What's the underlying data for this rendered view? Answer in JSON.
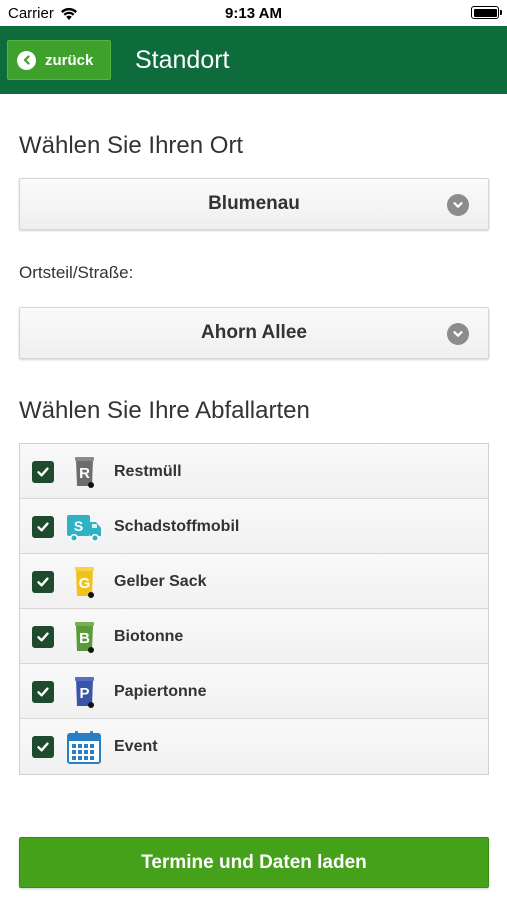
{
  "status_bar": {
    "carrier": "Carrier",
    "time": "9:13 AM",
    "wifi_icon": "wifi-icon",
    "battery_icon": "battery-icon"
  },
  "nav": {
    "back_label": "zurück",
    "title": "Standort"
  },
  "location": {
    "heading": "Wählen Sie Ihren Ort",
    "selected_place": "Blumenau",
    "district_label": "Ortsteil/Straße:",
    "selected_district": "Ahorn Allee"
  },
  "waste_types": {
    "heading": "Wählen Sie Ihre Abfallarten",
    "items": [
      {
        "label": "Restmüll",
        "checked": true,
        "icon": "restmuell-bin-icon",
        "letter": "R",
        "color": "#6d6d6d"
      },
      {
        "label": "Schadstoffmobil",
        "checked": true,
        "icon": "truck-icon",
        "letter": "S",
        "color": "#2fb3c3"
      },
      {
        "label": "Gelber Sack",
        "checked": true,
        "icon": "yellow-bin-icon",
        "letter": "G",
        "color": "#f0c21a"
      },
      {
        "label": "Biotonne",
        "checked": true,
        "icon": "bio-bin-icon",
        "letter": "B",
        "color": "#5a9a3a"
      },
      {
        "label": "Papiertonne",
        "checked": true,
        "icon": "paper-bin-icon",
        "letter": "P",
        "color": "#3a55a8"
      },
      {
        "label": "Event",
        "checked": true,
        "icon": "calendar-icon",
        "letter": "",
        "color": "#2a7fc4"
      }
    ]
  },
  "actions": {
    "load_label": "Termine und Daten laden"
  },
  "colors": {
    "nav_background": "#0d6b3c",
    "back_button": "#3da12b",
    "primary_button": "#45a11a",
    "checkbox": "#1e4a2d"
  }
}
